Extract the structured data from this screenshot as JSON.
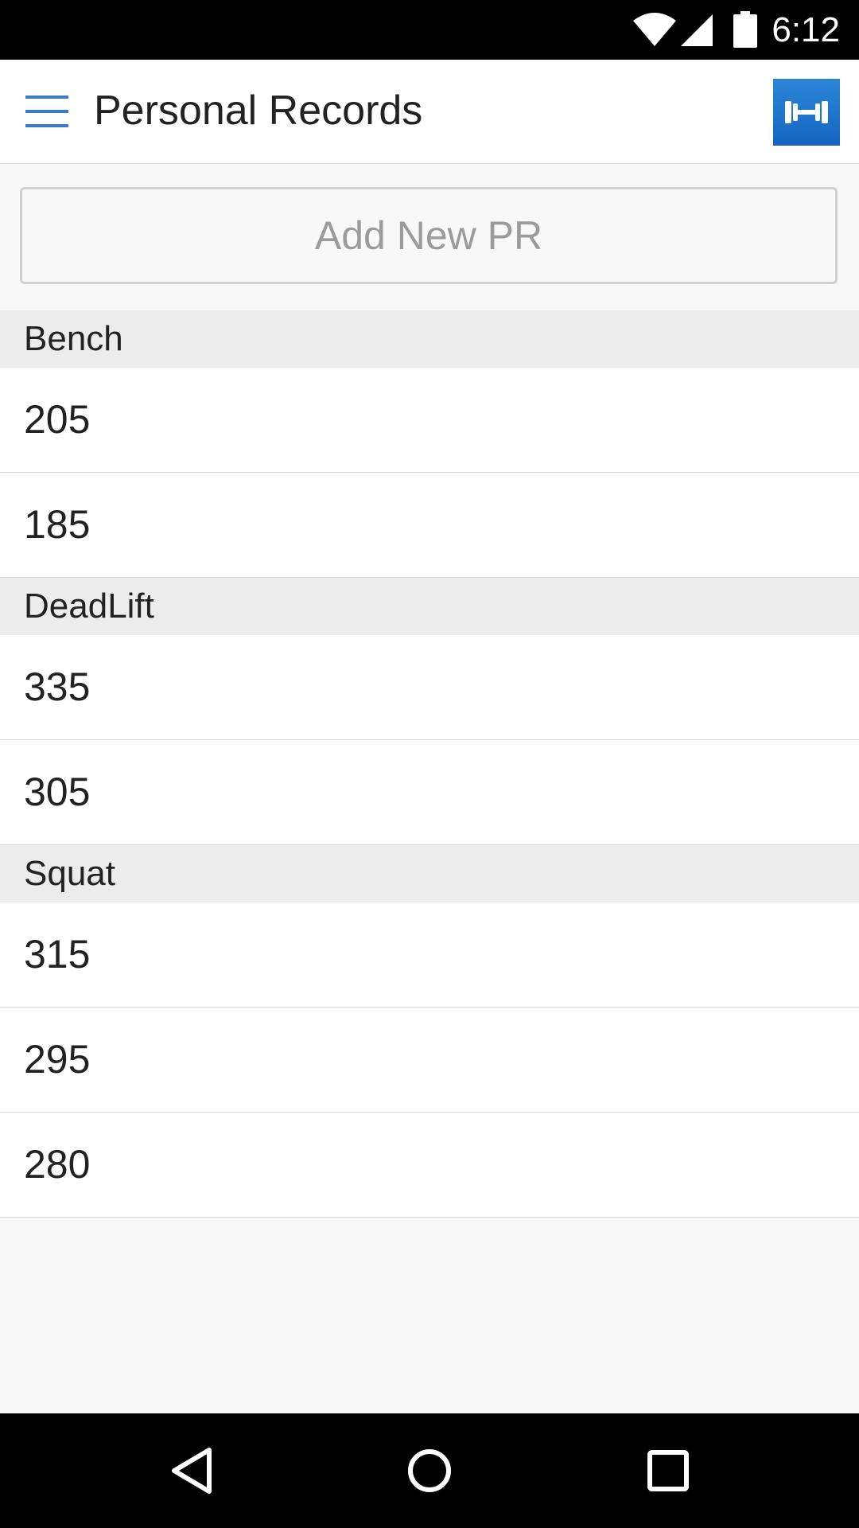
{
  "status_bar": {
    "time": "6:12",
    "icons": [
      "wifi-icon",
      "cell-signal-icon",
      "battery-icon"
    ]
  },
  "app_bar": {
    "title": "Personal Records",
    "menu_icon": "hamburger-menu-icon",
    "logo_icon": "dumbbell-icon",
    "logo_color": "#1e78d0"
  },
  "add_button": {
    "label": "Add New PR"
  },
  "records": [
    {
      "exercise": "Bench",
      "values": [
        "205",
        "185"
      ]
    },
    {
      "exercise": "DeadLift",
      "values": [
        "335",
        "305"
      ]
    },
    {
      "exercise": "Squat",
      "values": [
        "315",
        "295",
        "280"
      ]
    }
  ],
  "nav_bar": {
    "buttons": [
      "back-icon",
      "home-icon",
      "recents-icon"
    ]
  }
}
